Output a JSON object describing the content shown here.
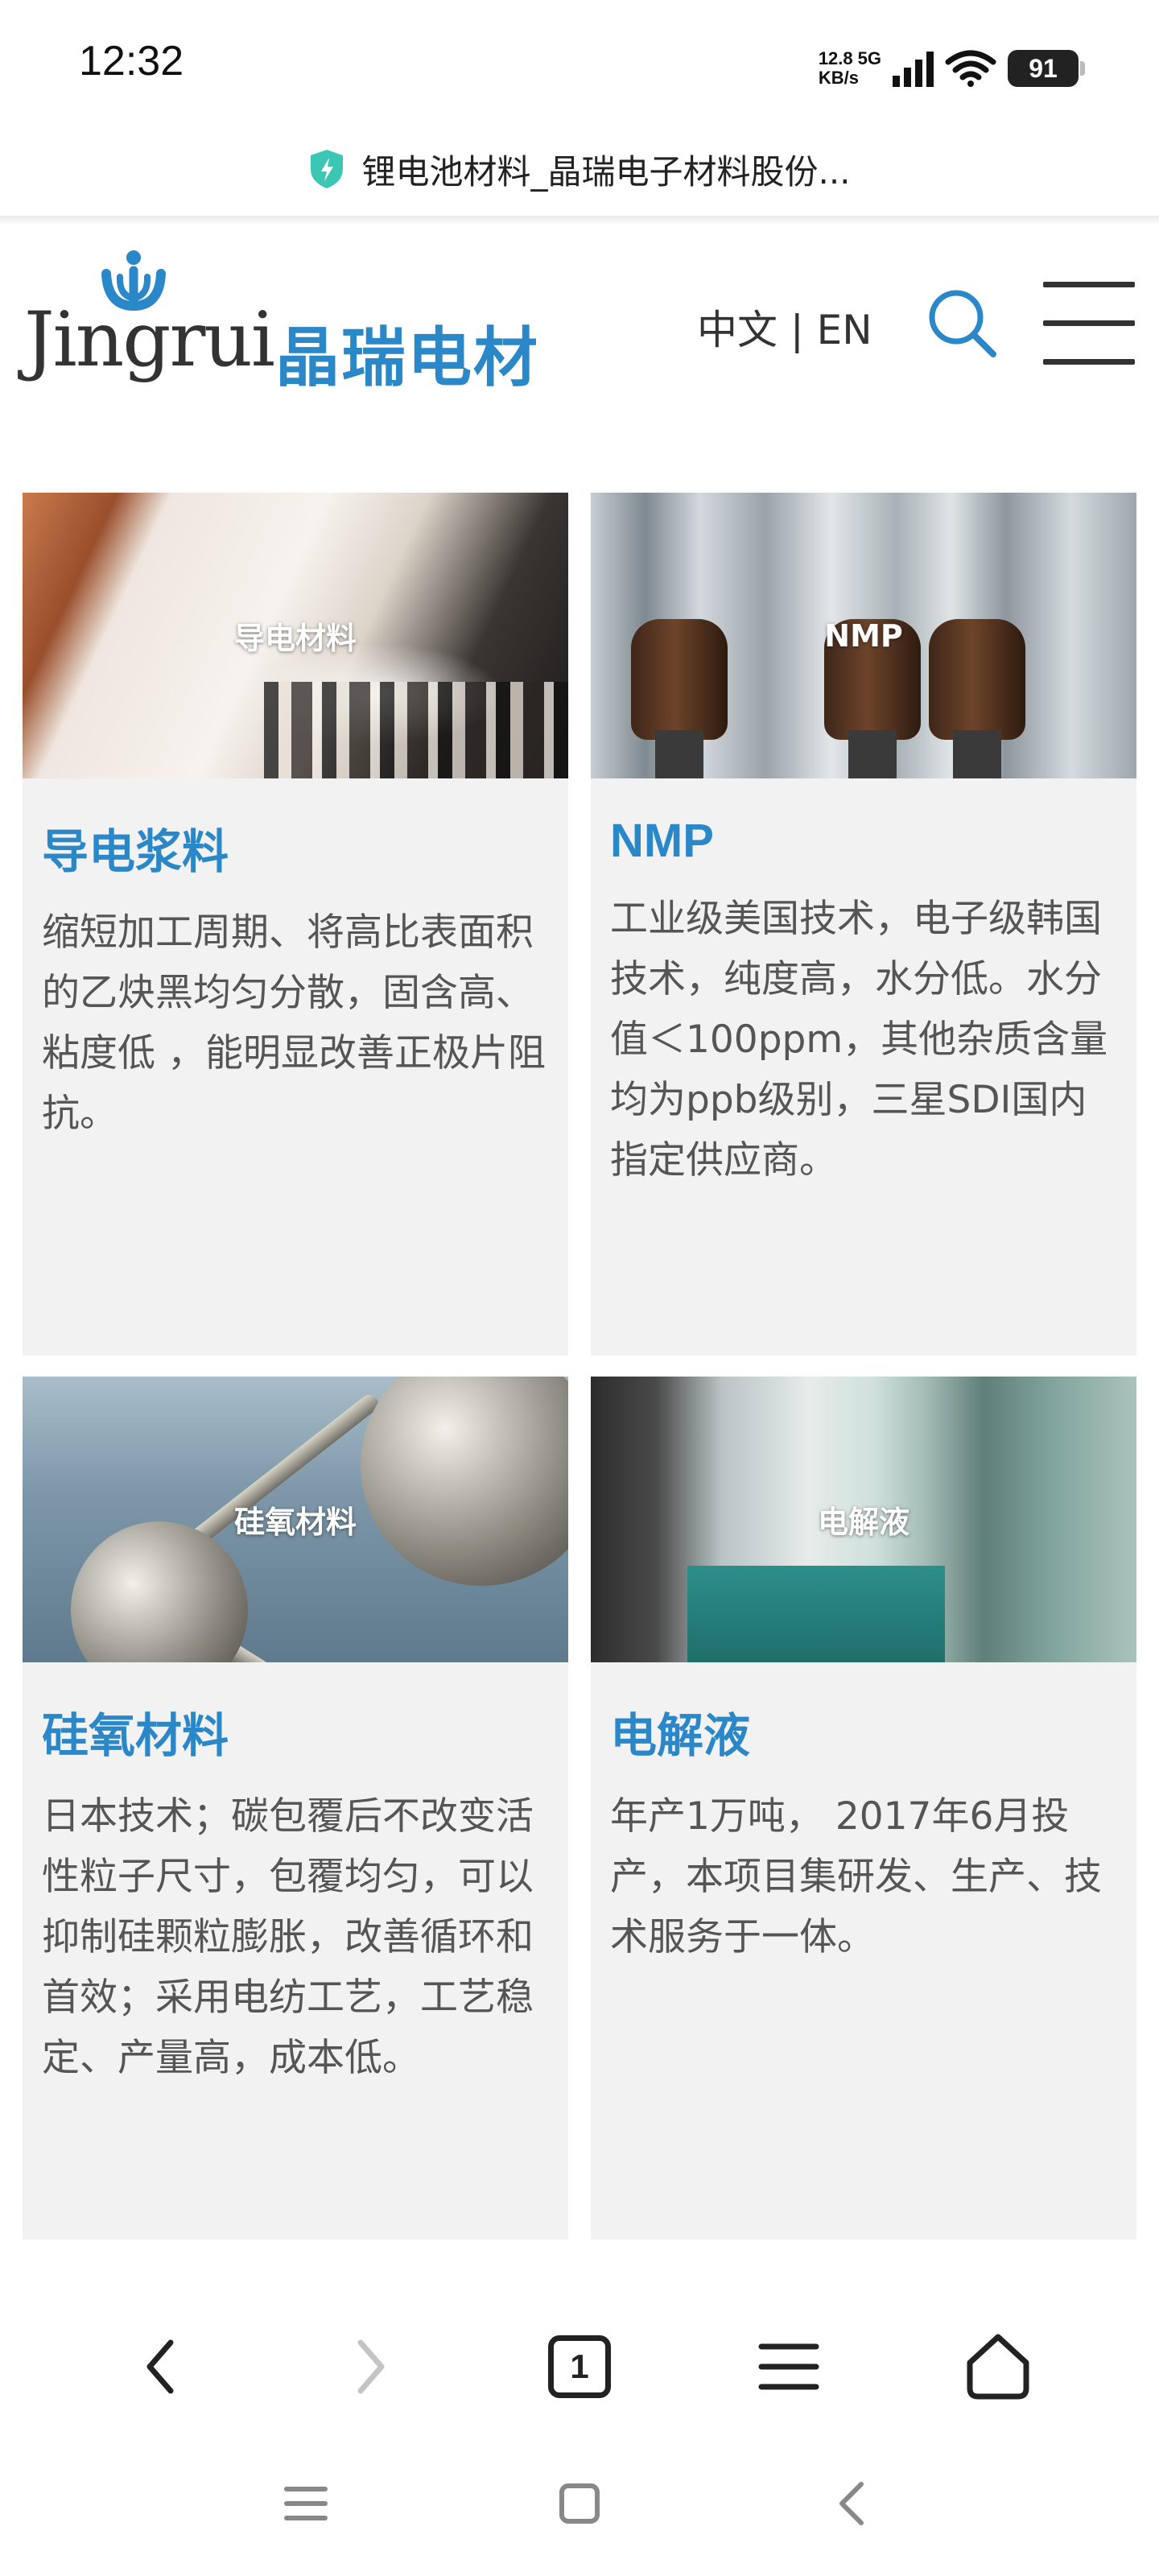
{
  "status_bar": {
    "time": "12:32",
    "net_speed_value": "12.8",
    "net_speed_unit": "KB/s",
    "network_type": "5G",
    "battery_level": "91"
  },
  "browser": {
    "page_title": "锂电池材料_晶瑞电子材料股份...",
    "tab_count": "1"
  },
  "header": {
    "logo_text_en": "Jingrui",
    "logo_text_cn": "晶瑞电材",
    "lang_switch": "中文 | EN"
  },
  "products": [
    {
      "image_label": "导电材料",
      "title": "导电浆料",
      "description": "缩短加工周期、将高比表面积的乙炔黑均匀分散，固含高、粘度低 ，能明显改善正极片阻抗。"
    },
    {
      "image_label": "NMP",
      "title": "NMP",
      "description": "工业级美国技术，电子级韩国技术，纯度高，水分低。水分值＜100ppm，其他杂质含量均为ppb级别，三星SDI国内指定供应商。"
    },
    {
      "image_label": "硅氧材料",
      "title": "硅氧材料",
      "description": "日本技术；碳包覆后不改变活性粒子尺寸，包覆均匀，可以抑制硅颗粒膨胀，改善循环和首效；采用电纺工艺，工艺稳定、产量高，成本低。"
    },
    {
      "image_label": "电解液",
      "title": "电解液",
      "description": "年产1万吨， 2017年6月投产，本项目集研发、生产、技术服务于一体。"
    }
  ],
  "colors": {
    "brand_blue": "#2a87c8",
    "shield_teal": "#3cc7b4",
    "card_bg": "#f2f2f2"
  },
  "icons": {
    "secure": "shield-icon",
    "search": "search-icon",
    "menu": "hamburger-menu-icon",
    "back": "back-arrow-icon",
    "forward": "forward-arrow-icon",
    "tabs": "tabs-icon",
    "browser_menu": "browser-menu-icon",
    "home": "home-icon"
  }
}
